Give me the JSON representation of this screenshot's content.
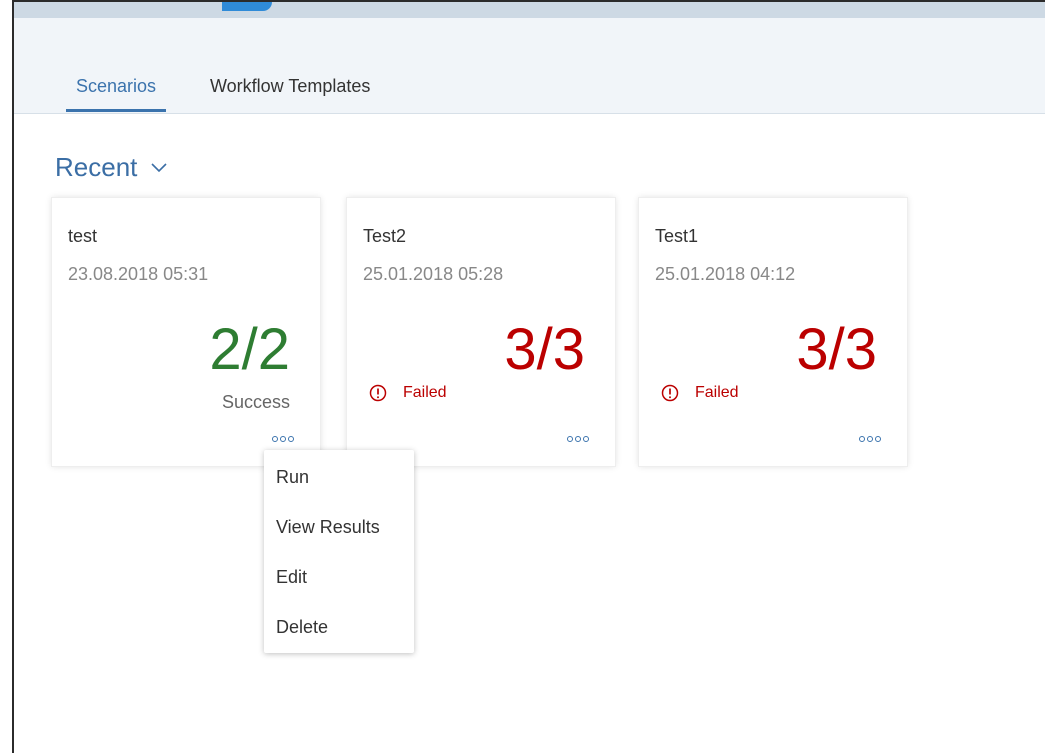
{
  "tabs": [
    {
      "label": "Scenarios",
      "selected": true
    },
    {
      "label": "Workflow Templates",
      "selected": false
    }
  ],
  "section": {
    "title": "Recent",
    "icon": "chevron-down-icon"
  },
  "cards": [
    {
      "name": "test",
      "date": "23.08.2018 05:31",
      "ratio": "2/2",
      "status": "Success",
      "status_color": "#2e7d32"
    },
    {
      "name": "Test2",
      "date": "25.01.2018 05:28",
      "ratio": "3/3",
      "status": "Failed",
      "status_color": "#bb0000"
    },
    {
      "name": "Test1",
      "date": "25.01.2018 04:12",
      "ratio": "3/3",
      "status": "Failed",
      "status_color": "#bb0000"
    }
  ],
  "context_menu": {
    "items": [
      "Run",
      "View Results",
      "Edit",
      "Delete"
    ]
  },
  "colors": {
    "accent": "#3b73ad",
    "success": "#2e7d32",
    "error": "#bb0000"
  }
}
